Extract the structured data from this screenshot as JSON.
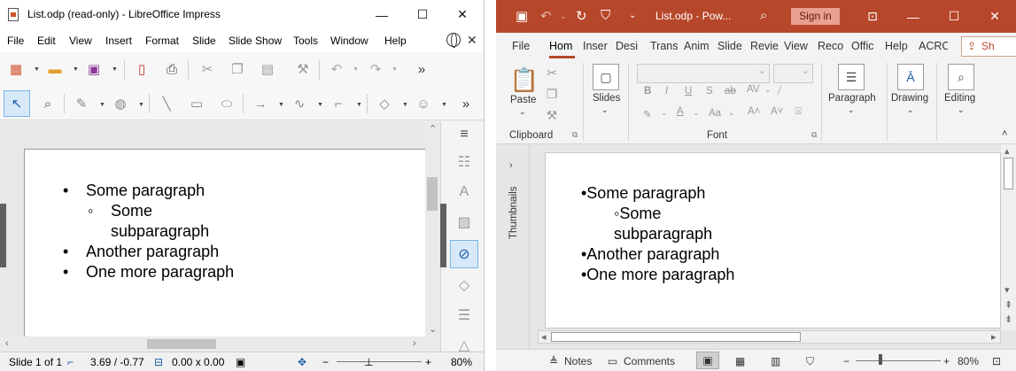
{
  "libreoffice": {
    "title": "List.odp (read-only) - LibreOffice Impress",
    "menu": [
      "File",
      "Edit",
      "View",
      "Insert",
      "Format",
      "Slide",
      "Slide Show",
      "Tools",
      "Window",
      "Help"
    ],
    "slide_items": {
      "item1": "Some paragraph",
      "sub1": "Some subparagraph",
      "item2": "Another paragraph",
      "item3": "One more paragraph"
    },
    "status": {
      "slide": "Slide 1 of 1",
      "position": "3.69 / -0.77",
      "size": "0.00 x 0.00",
      "zoom": "80%"
    }
  },
  "powerpoint": {
    "title": "List.odp - Pow...",
    "signin": "Sign in",
    "tabs": [
      "File",
      "Hom",
      "Inser",
      "Desi",
      "Trans",
      "Anim",
      "Slide",
      "Revie",
      "View",
      "Reco",
      "Offic",
      "Help",
      "ACRC"
    ],
    "share": "Sh",
    "ribbon": {
      "paste": "Paste",
      "clipboard": "Clipboard",
      "slides": "Slides",
      "font": "Font",
      "paragraph": "Paragraph",
      "drawing": "Drawing",
      "editing": "Editing"
    },
    "thumbnails": "Thumbnails",
    "slide_lines": {
      "line1": "•Some paragraph",
      "line2a": "◦Some",
      "line2b": "subparagraph",
      "line3": "•Another paragraph",
      "line4": "•One more paragraph"
    },
    "status": {
      "notes": "Notes",
      "comments": "Comments",
      "zoom": "80%"
    }
  }
}
